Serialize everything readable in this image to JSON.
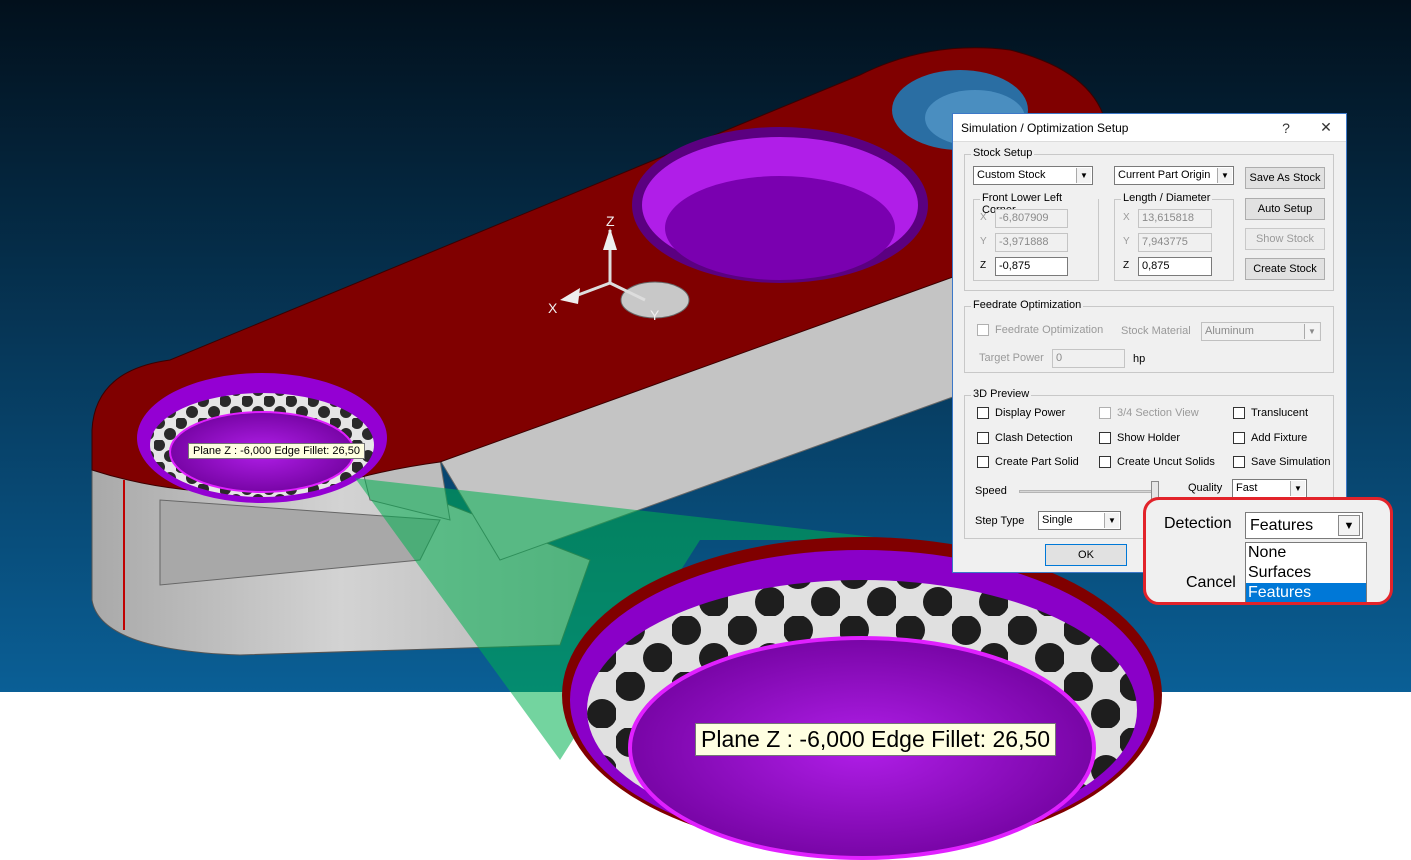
{
  "dialog": {
    "title": "Simulation / Optimization Setup",
    "help_label": "?",
    "close_label": "✕",
    "stock_setup": {
      "group_label": "Stock Setup",
      "stock_type": "Custom Stock",
      "origin": "Current Part Origin",
      "save_as_stock": "Save As Stock",
      "auto_setup": "Auto Setup",
      "show_stock": "Show Stock",
      "create_stock": "Create Stock",
      "front_lower_left": {
        "label": "Front Lower Left Corner",
        "x_label": "X",
        "x": "-6,807909",
        "y_label": "Y",
        "y": "-3,971888",
        "z_label": "Z",
        "z": "-0,875"
      },
      "length_diameter": {
        "label": "Length / Diameter",
        "x_label": "X",
        "x": "13,615818",
        "y_label": "Y",
        "y": "7,943775",
        "z_label": "Z",
        "z": "0,875"
      }
    },
    "feedrate": {
      "group_label": "Feedrate Optimization",
      "checkbox_label": "Feedrate Optimization",
      "stock_material_label": "Stock Material",
      "stock_material": "Aluminum",
      "target_power_label": "Target Power",
      "target_power": "0",
      "unit": "hp"
    },
    "preview": {
      "group_label": "3D Preview",
      "checkboxes": [
        "Display Power",
        "3/4 Section View",
        "Translucent",
        "Clash Detection",
        "Show Holder",
        "Add Fixture",
        "Create Part Solid",
        "Create Uncut Solids",
        "Save Simulation"
      ],
      "speed_label": "Speed",
      "quality_label": "Quality",
      "quality": "Fast",
      "step_type_label": "Step Type",
      "step_type": "Single"
    },
    "ok_label": "OK"
  },
  "callout": {
    "detection_label": "Detection",
    "detection_value": "Features",
    "options": [
      "None",
      "Surfaces",
      "Features"
    ],
    "cancel_label": "Cancel"
  },
  "viewport": {
    "tooltip_small": "Plane  Z : -6,000  Edge Fillet: 26,50",
    "tooltip_big": "Plane  Z : -6,000  Edge Fillet: 26,50",
    "axis_x": "X",
    "axis_y": "Y",
    "axis_z": "Z"
  },
  "colors": {
    "background_top": "#02101c",
    "background_bottom": "#0a5f96",
    "top_face": "#800000",
    "pocket": "#9400d3",
    "side_face": "#c8c8c8",
    "lens": "#00b050",
    "callout_border": "#e2232a",
    "selection": "#0078d7"
  }
}
